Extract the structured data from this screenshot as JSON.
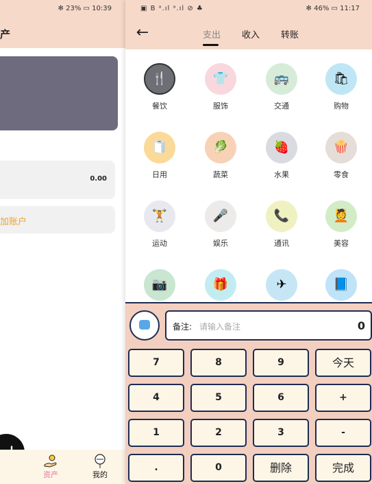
{
  "left_screen": {
    "status": {
      "battery": "23%",
      "time": "10:39"
    },
    "title": "产",
    "account_amount": "0.00",
    "add_account_label": "加账户",
    "fab_label": "+",
    "nav": [
      {
        "label": "资产",
        "icon": "hand-coin-icon"
      },
      {
        "label": "我的",
        "icon": "balloon-icon"
      }
    ]
  },
  "right_screen": {
    "status": {
      "left": "▣ B ᵃ.ıl ᵃ.ıl ⊘ ♣",
      "battery": "46%",
      "time": "11:17"
    },
    "tabs": [
      {
        "label": "支出"
      },
      {
        "label": "收入"
      },
      {
        "label": "转账"
      }
    ],
    "categories": [
      {
        "label": "餐饮",
        "icon": "utensils-icon",
        "color": "#6e6e76",
        "glyph": "🍴",
        "selected": true
      },
      {
        "label": "服饰",
        "icon": "tshirt-icon",
        "color": "#f8d8dc",
        "glyph": "👕"
      },
      {
        "label": "交通",
        "icon": "bus-icon",
        "color": "#d6ecd9",
        "glyph": "🚌"
      },
      {
        "label": "购物",
        "icon": "shopping-bag-icon",
        "color": "#bfe6f4",
        "glyph": "🛍"
      },
      {
        "label": "日用",
        "icon": "toilet-paper-icon",
        "color": "#fbd998",
        "glyph": "🧻"
      },
      {
        "label": "蔬菜",
        "icon": "vegetable-basket-icon",
        "color": "#f8d2b6",
        "glyph": "🥬"
      },
      {
        "label": "水果",
        "icon": "fruit-icon",
        "color": "#d9dbe0",
        "glyph": "🍓"
      },
      {
        "label": "零食",
        "icon": "popcorn-icon",
        "color": "#e6ddd8",
        "glyph": "🍿"
      },
      {
        "label": "运动",
        "icon": "dumbbell-icon",
        "color": "#e8e9ee",
        "glyph": "🏋"
      },
      {
        "label": "娱乐",
        "icon": "microphone-icon",
        "color": "#ecebea",
        "glyph": "🎤"
      },
      {
        "label": "通讯",
        "icon": "phone-icon",
        "color": "#f0f1c0",
        "glyph": "📞"
      },
      {
        "label": "美容",
        "icon": "beauty-icon",
        "color": "#d3ecc8",
        "glyph": "💆"
      },
      {
        "label": "",
        "icon": "camera-icon",
        "color": "#c9e6d0",
        "glyph": "📷"
      },
      {
        "label": "",
        "icon": "gift-icon",
        "color": "#c3ecf2",
        "glyph": "🎁"
      },
      {
        "label": "",
        "icon": "airplane-icon",
        "color": "#c6e6f6",
        "glyph": "✈"
      },
      {
        "label": "",
        "icon": "book-icon",
        "color": "#bfe3f8",
        "glyph": "📘"
      }
    ],
    "memo": {
      "label": "备注:",
      "placeholder": "请输入备注",
      "amount": "0"
    },
    "keys": [
      [
        "7",
        "8",
        "9",
        "今天"
      ],
      [
        "4",
        "5",
        "6",
        "+"
      ],
      [
        "1",
        "2",
        "3",
        "-"
      ],
      [
        ".",
        "0",
        "删除",
        "完成"
      ]
    ],
    "colors": {
      "header": "#f6d9c9",
      "keypad_bg": "#f3cfc0",
      "key_bg": "#fdf6e7",
      "outline": "#1d2b52"
    }
  }
}
